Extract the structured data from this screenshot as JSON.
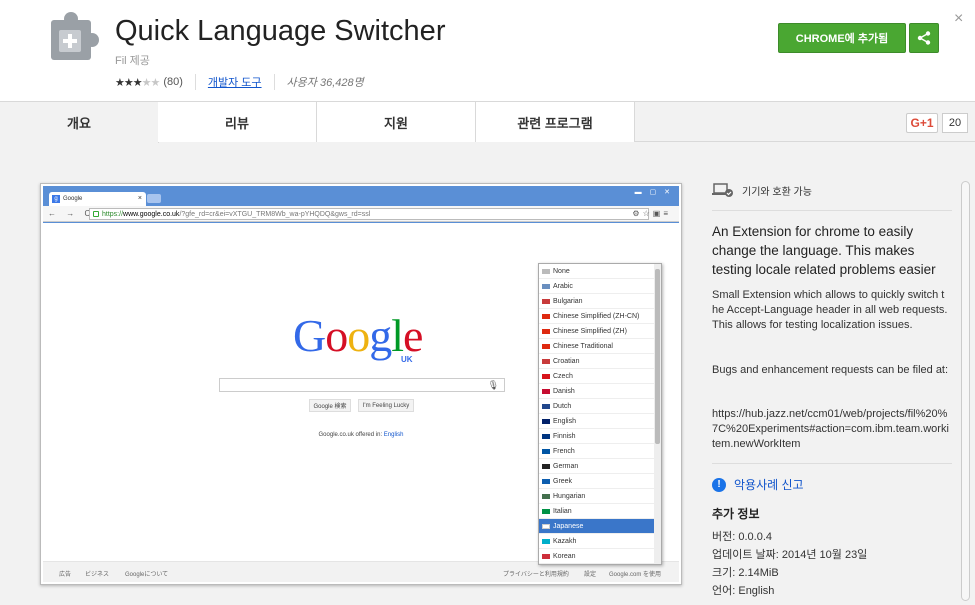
{
  "header": {
    "title": "Quick Language Switcher",
    "provider": "Fil 제공",
    "rating_count": "(80)",
    "category": "개발자 도구",
    "users": "사용자 36,428명",
    "add_button": "CHROME에 추가됨",
    "close": "×",
    "rating_stars": 3
  },
  "tabs": [
    {
      "label": "개요"
    },
    {
      "label": "리뷰"
    },
    {
      "label": "지원"
    },
    {
      "label": "관련 프로그램"
    }
  ],
  "gplus": {
    "label": "G+1",
    "count": "20"
  },
  "screenshot": {
    "tab_title": "Google",
    "url_proto": "https://",
    "url_host": "www.google.co.uk",
    "url_rest": "/?gfe_rd=cr&ei=vXTGU_TRM8Wb_wa-pYHQDQ&gws_rd=ssl",
    "google_region": "UK",
    "btn_search": "Google 検索",
    "btn_lucky": "I'm Feeling Lucky",
    "offered_text": "Google.co.uk offered in:",
    "offered_link": "English",
    "footer_left": [
      "広告",
      "ビジネス",
      "Googleについて"
    ],
    "footer_right": [
      "プライバシーと利用規約",
      "設定",
      "Google.com を使用"
    ],
    "languages": [
      {
        "name": "None",
        "flag": "#bbbbbb"
      },
      {
        "name": "Arabic",
        "flag": "#6a8fbf"
      },
      {
        "name": "Bulgarian",
        "flag": "#c83a3a"
      },
      {
        "name": "Chinese Simplified (ZH-CN)",
        "flag": "#de2910"
      },
      {
        "name": "Chinese Simplified (ZH)",
        "flag": "#de2910"
      },
      {
        "name": "Chinese Traditional",
        "flag": "#de2910"
      },
      {
        "name": "Croatian",
        "flag": "#c83a3a"
      },
      {
        "name": "Czech",
        "flag": "#d7141a"
      },
      {
        "name": "Danish",
        "flag": "#c60c30"
      },
      {
        "name": "Dutch",
        "flag": "#21468b"
      },
      {
        "name": "English",
        "flag": "#012169"
      },
      {
        "name": "Finnish",
        "flag": "#003580"
      },
      {
        "name": "French",
        "flag": "#0055a4"
      },
      {
        "name": "German",
        "flag": "#222222"
      },
      {
        "name": "Greek",
        "flag": "#0d5eaf"
      },
      {
        "name": "Hungarian",
        "flag": "#436f4d"
      },
      {
        "name": "Italian",
        "flag": "#009246"
      },
      {
        "name": "Japanese",
        "flag": "#ffffff"
      },
      {
        "name": "Kazakh",
        "flag": "#00afca"
      },
      {
        "name": "Korean",
        "flag": "#cd2e3a"
      }
    ],
    "selected_language": "Japanese"
  },
  "sidebar": {
    "compat": "기기와 호환 가능",
    "description": "An Extension for chrome to easily change the language. This makes testing locale related problems easier",
    "para1": "Small Extension which allows to quickly switch the Accept-Language header in all web requests. This allows for testing localization issues.",
    "para2": "Bugs and enhancement requests can be filed at:",
    "para3": "https://hub.jazz.net/ccm01/web/projects/fil%20%7C%20Experiments#action=com.ibm.team.workitem.newWorkItem",
    "report": "악용사례 신고",
    "additional_info": "추가 정보",
    "version": "버전: 0.0.0.4",
    "updated": "업데이트 날짜: 2014년 10월 23일",
    "size": "크기: 2.14MiB",
    "language": "언어: English"
  },
  "colors": {
    "accent_green": "#4aa732",
    "link_blue": "#1155cc",
    "selected_blue": "#3a76c9"
  }
}
